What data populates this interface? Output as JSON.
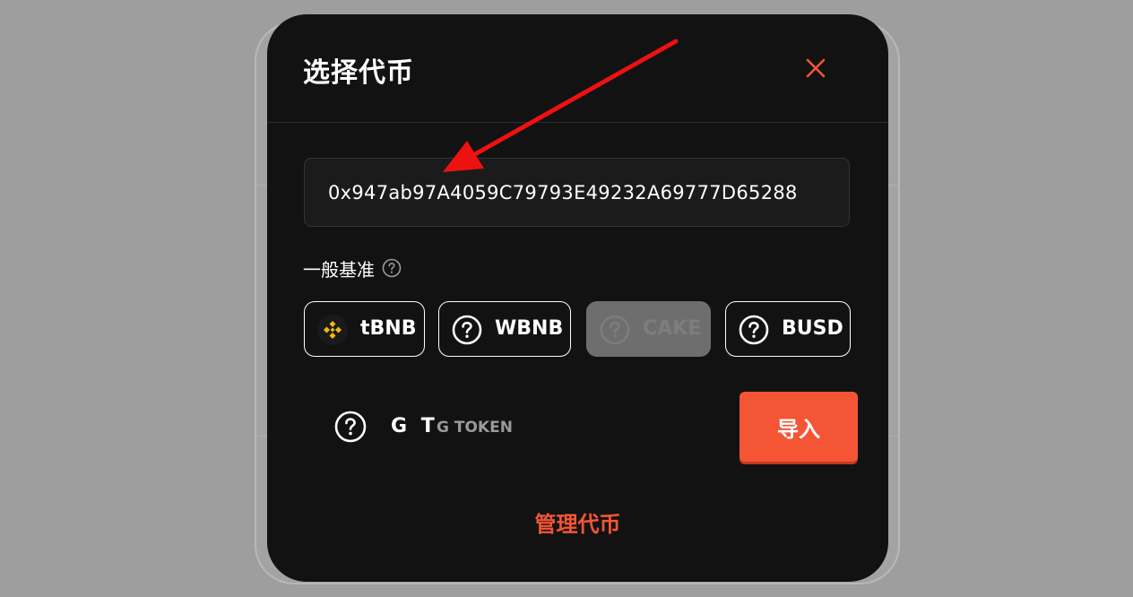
{
  "modal": {
    "title": "选择代币",
    "close_icon": "close-icon",
    "accent_color": "#f45535"
  },
  "search": {
    "value": "0x947ab97A4059C79793E49232A69777D65288",
    "placeholder": ""
  },
  "base_section": {
    "label": "一般基准",
    "help_icon": "question-circle-icon"
  },
  "base_tokens": [
    {
      "symbol": "tBNB",
      "icon": "bnb-icon",
      "disabled": false
    },
    {
      "symbol": "WBNB",
      "icon": "question-circle-icon",
      "disabled": false
    },
    {
      "symbol": "CAKE",
      "icon": "question-circle-icon",
      "disabled": true
    },
    {
      "symbol": "BUSD",
      "icon": "question-circle-icon",
      "disabled": false
    }
  ],
  "found_token": {
    "symbol": "G T",
    "name": "G TOKEN",
    "icon": "question-circle-icon",
    "import_label": "导入"
  },
  "manage_label": "管理代币",
  "annotation": {
    "arrow_icon": "red-arrow-icon",
    "arrow_color": "#ee1111"
  }
}
